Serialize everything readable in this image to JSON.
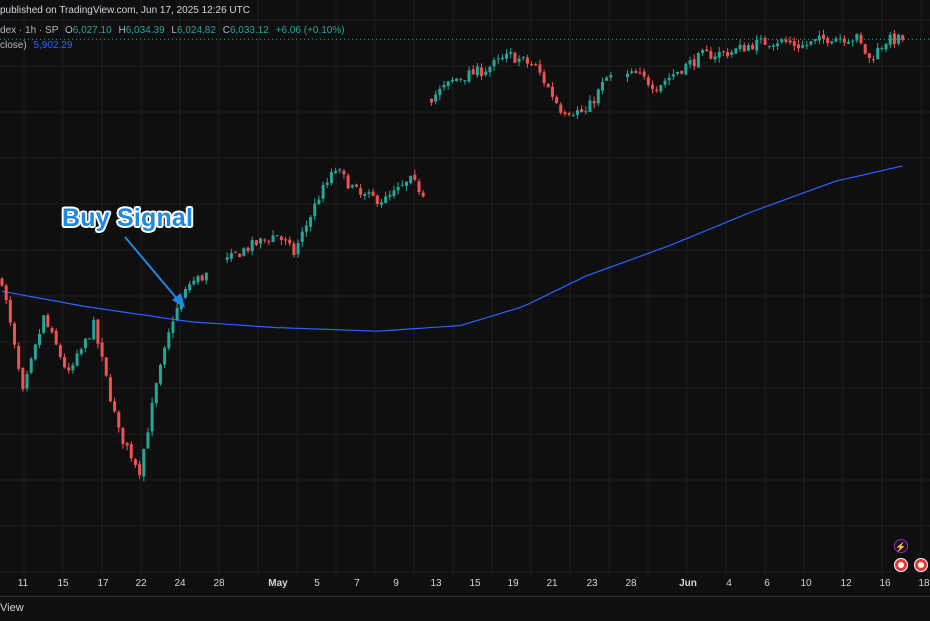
{
  "header": {
    "published": "published on TradingView.com, Jun 17, 2025 12:26 UTC",
    "symbol": "dex · 1h · SP",
    "ohlc": [
      {
        "label": "O",
        "value": "6,027.10"
      },
      {
        "label": "H",
        "value": "6,034.39"
      },
      {
        "label": "L",
        "value": "6,024.82"
      },
      {
        "label": "C",
        "value": "6,033.12"
      }
    ],
    "change": "+6.06 (+0.10%)",
    "ma_label": "close)",
    "ma_value": "5,902.29"
  },
  "annotation": {
    "text": "Buy Signal",
    "color": "#1e88e5"
  },
  "time_axis": {
    "ticks": [
      {
        "label": "11",
        "bold": false
      },
      {
        "label": "15",
        "bold": false
      },
      {
        "label": "17",
        "bold": false
      },
      {
        "label": "22",
        "bold": false
      },
      {
        "label": "24",
        "bold": false
      },
      {
        "label": "28",
        "bold": false
      },
      {
        "label": "May",
        "bold": true
      },
      {
        "label": "5",
        "bold": false
      },
      {
        "label": "7",
        "bold": false
      },
      {
        "label": "9",
        "bold": false
      },
      {
        "label": "13",
        "bold": false
      },
      {
        "label": "15",
        "bold": false
      },
      {
        "label": "19",
        "bold": false
      },
      {
        "label": "21",
        "bold": false
      },
      {
        "label": "23",
        "bold": false
      },
      {
        "label": "28",
        "bold": false
      },
      {
        "label": "Jun",
        "bold": true
      },
      {
        "label": "4",
        "bold": false
      },
      {
        "label": "6",
        "bold": false
      },
      {
        "label": "10",
        "bold": false
      },
      {
        "label": "12",
        "bold": false
      },
      {
        "label": "16",
        "bold": false
      },
      {
        "label": "18",
        "bold": false
      }
    ]
  },
  "footer": {
    "text": "View"
  },
  "icons": {
    "flash": "lightning-icon",
    "flags": [
      "us-flag-icon",
      "us-flag-icon"
    ]
  },
  "colors": {
    "up": "#26a69a",
    "down": "#ef5350",
    "ma": "#2962ff",
    "background": "#0f0f0f",
    "grid": "#1e1e1e"
  },
  "chart_data": {
    "type": "candlestick",
    "title": "",
    "xlabel": "",
    "ylabel": "",
    "grid": true,
    "x_tick_labels": [
      "11",
      "15",
      "17",
      "22",
      "24",
      "28",
      "May",
      "5",
      "7",
      "9",
      "13",
      "15",
      "19",
      "21",
      "23",
      "28",
      "Jun",
      "4",
      "6",
      "10",
      "12",
      "16",
      "18"
    ],
    "anchors": [
      {
        "i": 0,
        "p": 5400
      },
      {
        "i": 5,
        "p": 5100
      },
      {
        "i": 10,
        "p": 5300
      },
      {
        "i": 16,
        "p": 5150
      },
      {
        "i": 22,
        "p": 5280
      },
      {
        "i": 28,
        "p": 5000
      },
      {
        "i": 33,
        "p": 4900
      },
      {
        "i": 37,
        "p": 5120
      },
      {
        "i": 41,
        "p": 5300
      },
      {
        "i": 45,
        "p": 5390
      },
      {
        "i": 50,
        "p": 5420
      },
      {
        "i": 58,
        "p": 5480
      },
      {
        "i": 66,
        "p": 5520
      },
      {
        "i": 70,
        "p": 5470
      },
      {
        "i": 76,
        "p": 5620
      },
      {
        "i": 80,
        "p": 5690
      },
      {
        "i": 86,
        "p": 5620
      },
      {
        "i": 92,
        "p": 5610
      },
      {
        "i": 98,
        "p": 5660
      },
      {
        "i": 101,
        "p": 5630
      },
      {
        "i": 103,
        "p": 5880
      },
      {
        "i": 109,
        "p": 5930
      },
      {
        "i": 115,
        "p": 5950
      },
      {
        "i": 122,
        "p": 5990
      },
      {
        "i": 128,
        "p": 5960
      },
      {
        "i": 134,
        "p": 5850
      },
      {
        "i": 140,
        "p": 5840
      },
      {
        "i": 145,
        "p": 5930
      },
      {
        "i": 152,
        "p": 5940
      },
      {
        "i": 157,
        "p": 5910
      },
      {
        "i": 162,
        "p": 5950
      },
      {
        "i": 168,
        "p": 5990
      },
      {
        "i": 175,
        "p": 6000
      },
      {
        "i": 180,
        "p": 6020
      },
      {
        "i": 186,
        "p": 6030
      },
      {
        "i": 192,
        "p": 6015
      },
      {
        "i": 199,
        "p": 6040
      },
      {
        "i": 205,
        "p": 6035
      },
      {
        "i": 208,
        "p": 5980
      },
      {
        "i": 212,
        "p": 6030
      },
      {
        "i": 216,
        "p": 6033
      }
    ],
    "gap_indices": [
      50,
      51,
      52,
      53,
      102,
      147,
      148,
      149
    ],
    "ma_series": [
      {
        "i": 0,
        "p": 5370
      },
      {
        "i": 20,
        "p": 5330
      },
      {
        "i": 45,
        "p": 5290
      },
      {
        "i": 65,
        "p": 5275
      },
      {
        "i": 90,
        "p": 5265
      },
      {
        "i": 110,
        "p": 5280
      },
      {
        "i": 125,
        "p": 5330
      },
      {
        "i": 140,
        "p": 5410
      },
      {
        "i": 160,
        "p": 5490
      },
      {
        "i": 180,
        "p": 5580
      },
      {
        "i": 200,
        "p": 5660
      },
      {
        "i": 216,
        "p": 5700
      }
    ],
    "y_range": [
      4650,
      6110
    ],
    "last_price": 6033.12
  }
}
